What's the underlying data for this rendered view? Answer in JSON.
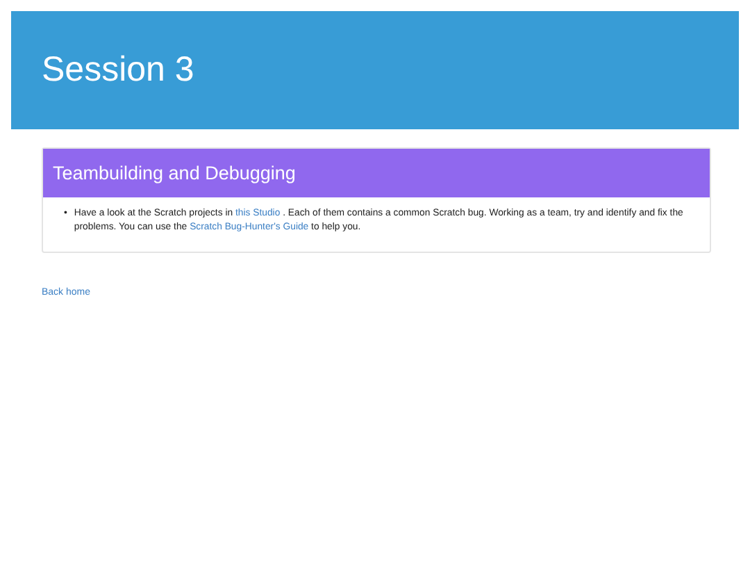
{
  "header": {
    "title": "Session 3"
  },
  "panel": {
    "title": "Teambuilding and Debugging",
    "items": [
      {
        "marker": "•",
        "parts": [
          {
            "kind": "text",
            "text": "Have a look at the Scratch projects in "
          },
          {
            "kind": "link",
            "text": "this Studio"
          },
          {
            "kind": "text",
            "text": " . Each of them contains a common Scratch bug. Working as a team, try and identify and fix the problems. You can use the "
          },
          {
            "kind": "link",
            "text": "Scratch Bug-Hunter's Guide"
          },
          {
            "kind": "text",
            "text": " to help you."
          }
        ]
      }
    ]
  },
  "back_link": "Back home"
}
